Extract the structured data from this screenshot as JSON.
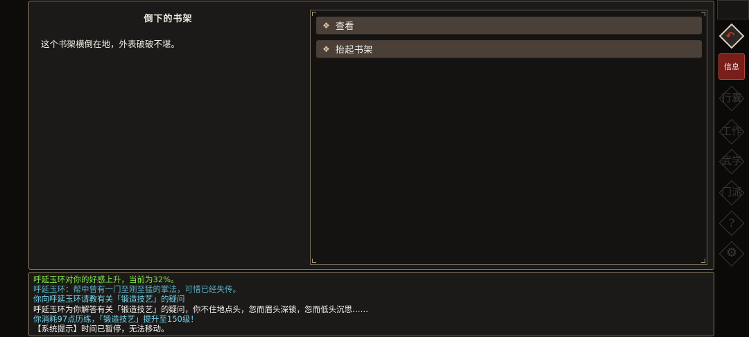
{
  "scene": {
    "title": "倒下的书架",
    "description": "这个书架横倒在地，外表破破不堪。"
  },
  "actions": [
    {
      "label": "查看"
    },
    {
      "label": "抬起书架"
    }
  ],
  "log": [
    {
      "text": "呼延玉环对你的好感上升，当前为32%。",
      "color": "#7fe34a"
    },
    {
      "text": "呼延玉环：帮中曾有一门至刚至猛的掌法，可惜已经失传。",
      "color": "#5bb3c9"
    },
    {
      "text": "你向呼延玉环请教有关「锻造技艺」的疑问",
      "color": "#74d6ee"
    },
    {
      "text": "呼延玉环为你解答有关「锻造技艺」的疑问，你不住地点头，忽而眉头深锁，忽而低头沉思……",
      "color": "#f2f2f2"
    },
    {
      "text": "你消耗97点历练，「锻造技艺」提升至150级！",
      "color": "#74d6ee"
    },
    {
      "text": "【系统提示】时间已暂停，无法移动。",
      "color": "#f2f2f2"
    }
  ],
  "sidebar": {
    "info_label": "信息",
    "nav_items": [
      {
        "label": "行囊"
      },
      {
        "label": "工作"
      },
      {
        "label": "武学"
      },
      {
        "label": "门派"
      }
    ],
    "help_label": "?",
    "settings_icon": "gear-icon",
    "back_icon": "return-arrow-icon"
  }
}
